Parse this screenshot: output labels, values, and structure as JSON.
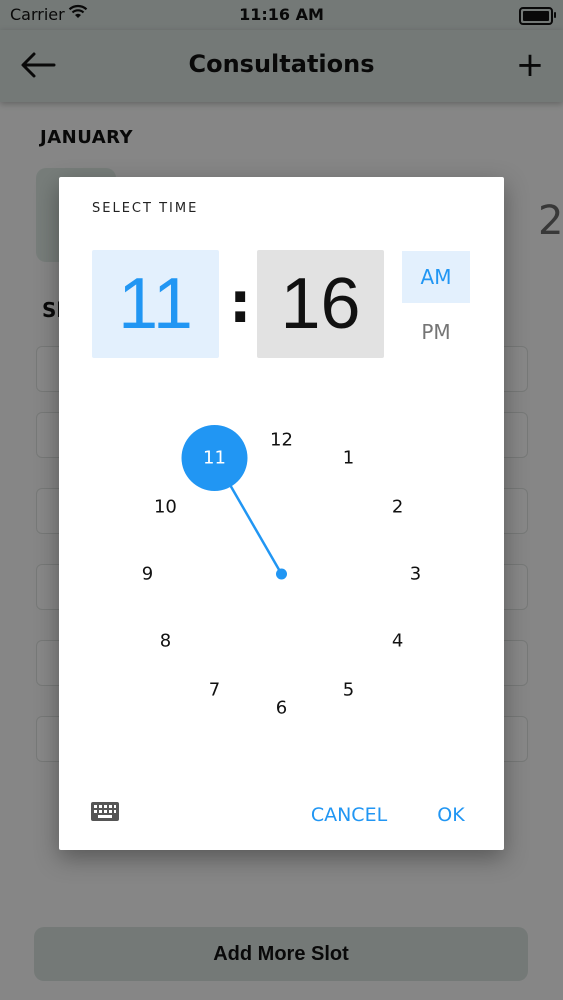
{
  "status_bar": {
    "carrier": "Carrier",
    "time": "11:16 AM"
  },
  "nav": {
    "title": "Consultations",
    "back_icon": "arrow-left-icon",
    "add_icon": "plus-icon",
    "add_label": "+"
  },
  "background": {
    "month": "JANUARY",
    "section_label": "Sl",
    "date_next": "2",
    "add_slot_label": "Add More Slot"
  },
  "dialog": {
    "title": "SELECT TIME",
    "hour": "11",
    "colon": ":",
    "minute": "16",
    "am_label": "AM",
    "pm_label": "PM",
    "selected_period": "AM",
    "clock_numbers": [
      "12",
      "1",
      "2",
      "3",
      "4",
      "5",
      "6",
      "7",
      "8",
      "9",
      "10",
      "11"
    ],
    "selected_hour": "11",
    "accent_color": "#2196f3",
    "keyboard_icon": "keyboard-icon",
    "cancel_label": "CANCEL",
    "ok_label": "OK"
  }
}
